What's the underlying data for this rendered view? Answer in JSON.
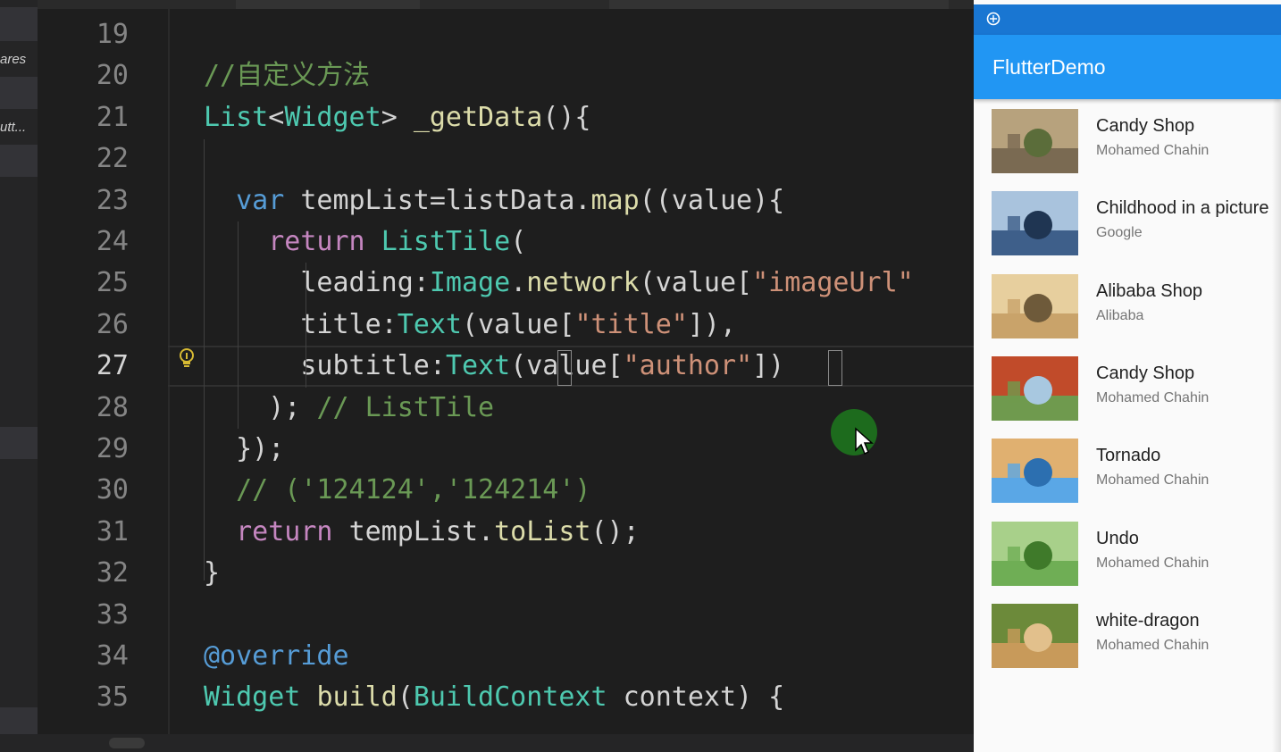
{
  "explorer": {
    "labels": [
      "ares",
      "utt..."
    ]
  },
  "editor": {
    "current_line": "27",
    "lines": [
      {
        "n": "19",
        "tokens": []
      },
      {
        "n": "20",
        "tokens": [
          {
            "t": "//自定义方法",
            "c": "c-comment"
          }
        ]
      },
      {
        "n": "21",
        "tokens": [
          {
            "t": "List",
            "c": "c-type"
          },
          {
            "t": "<",
            "c": "c-var"
          },
          {
            "t": "Widget",
            "c": "c-type"
          },
          {
            "t": "> ",
            "c": "c-var"
          },
          {
            "t": "_getData",
            "c": "c-fn"
          },
          {
            "t": "(){",
            "c": "c-var"
          }
        ]
      },
      {
        "n": "22",
        "tokens": []
      },
      {
        "n": "23",
        "tokens": [
          {
            "t": "  var ",
            "c": "c-kw"
          },
          {
            "t": "tempList=listData.",
            "c": "c-var"
          },
          {
            "t": "map",
            "c": "c-fn"
          },
          {
            "t": "((value){",
            "c": "c-var"
          }
        ]
      },
      {
        "n": "24",
        "tokens": [
          {
            "t": "    return ",
            "c": "c-ctrl"
          },
          {
            "t": "ListTile",
            "c": "c-type"
          },
          {
            "t": "(",
            "c": "c-var"
          }
        ]
      },
      {
        "n": "25",
        "tokens": [
          {
            "t": "      leading:",
            "c": "c-var"
          },
          {
            "t": "Image",
            "c": "c-type"
          },
          {
            "t": ".",
            "c": "c-var"
          },
          {
            "t": "network",
            "c": "c-fn"
          },
          {
            "t": "(value[",
            "c": "c-var"
          },
          {
            "t": "\"imageUrl\"",
            "c": "c-str"
          }
        ]
      },
      {
        "n": "26",
        "tokens": [
          {
            "t": "      title:",
            "c": "c-var"
          },
          {
            "t": "Text",
            "c": "c-type"
          },
          {
            "t": "(value[",
            "c": "c-var"
          },
          {
            "t": "\"title\"",
            "c": "c-str"
          },
          {
            "t": "]),",
            "c": "c-var"
          }
        ]
      },
      {
        "n": "27",
        "tokens": [
          {
            "t": "      subtitle:",
            "c": "c-var"
          },
          {
            "t": "Text",
            "c": "c-type"
          },
          {
            "t": "(value[",
            "c": "c-var"
          },
          {
            "t": "\"author\"",
            "c": "c-str"
          },
          {
            "t": "])",
            "c": "c-var"
          }
        ]
      },
      {
        "n": "28",
        "tokens": [
          {
            "t": "    ); ",
            "c": "c-var"
          },
          {
            "t": "// ListTile",
            "c": "c-comment"
          }
        ]
      },
      {
        "n": "29",
        "tokens": [
          {
            "t": "  });",
            "c": "c-var"
          }
        ]
      },
      {
        "n": "30",
        "tokens": [
          {
            "t": "  // ('124124','124214')",
            "c": "c-comment"
          }
        ]
      },
      {
        "n": "31",
        "tokens": [
          {
            "t": "  return ",
            "c": "c-ctrl"
          },
          {
            "t": "tempList.",
            "c": "c-var"
          },
          {
            "t": "toList",
            "c": "c-fn"
          },
          {
            "t": "();",
            "c": "c-var"
          }
        ]
      },
      {
        "n": "32",
        "tokens": [
          {
            "t": "}",
            "c": "c-var"
          }
        ]
      },
      {
        "n": "33",
        "tokens": []
      },
      {
        "n": "34",
        "tokens": [
          {
            "t": "@override",
            "c": "c-kw"
          }
        ]
      },
      {
        "n": "35",
        "tokens": [
          {
            "t": "Widget ",
            "c": "c-type"
          },
          {
            "t": "build",
            "c": "c-fn"
          },
          {
            "t": "(",
            "c": "c-var"
          },
          {
            "t": "BuildContext",
            "c": "c-type"
          },
          {
            "t": " context) {",
            "c": "c-var"
          }
        ]
      }
    ]
  },
  "app": {
    "title": "FlutterDemo",
    "items": [
      {
        "title": "Candy Shop",
        "subtitle": "Mohamed Chahin"
      },
      {
        "title": "Childhood in a picture",
        "subtitle": "Google"
      },
      {
        "title": "Alibaba Shop",
        "subtitle": "Alibaba"
      },
      {
        "title": "Candy Shop",
        "subtitle": "Mohamed Chahin"
      },
      {
        "title": "Tornado",
        "subtitle": "Mohamed Chahin"
      },
      {
        "title": "Undo",
        "subtitle": "Mohamed Chahin"
      },
      {
        "title": "white-dragon",
        "subtitle": "Mohamed Chahin"
      }
    ]
  }
}
